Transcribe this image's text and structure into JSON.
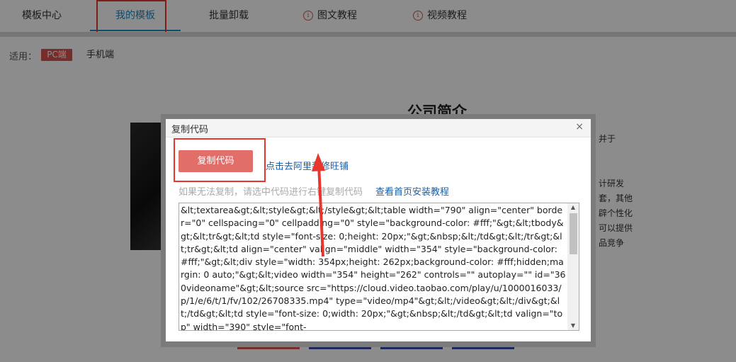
{
  "nav": {
    "items": [
      {
        "label": "模板中心"
      },
      {
        "label": "我的模板"
      },
      {
        "label": "批量卸载"
      },
      {
        "label": "图文教程"
      },
      {
        "label": "视频教程"
      }
    ],
    "info_glyph": "i"
  },
  "filter": {
    "label": "适用：",
    "options": [
      {
        "label": "PC端",
        "selected": true
      },
      {
        "label": "手机端",
        "selected": false
      }
    ]
  },
  "background": {
    "title": "公司简介",
    "snippets": [
      "并于",
      "计研发",
      "套，其他",
      "辟个性化",
      "可以提供",
      "品竞争"
    ]
  },
  "modal": {
    "title": "复制代码",
    "close_glyph": "×",
    "copy_button": "复制代码",
    "shop_link": "点击去阿里装修旺铺",
    "hint": "如果无法复制，请选中代码进行右键复制代码",
    "tutorial_link": "查看首页安装教程",
    "code": "&lt;textarea&gt;&lt;style&gt;&lt;/style&gt;&lt;table width=\"790\" align=\"center\" border=\"0\" cellspacing=\"0\" cellpadding=\"0\" style=\"background-color: #fff;\"&gt;&lt;tbody&gt;&lt;tr&gt;&lt;td style=\"font-size: 0;height: 20px;\"&gt;&nbsp;&lt;/td&gt;&lt;/tr&gt;&lt;tr&gt;&lt;td align=\"center\" valign=\"middle\" width=\"354\" style=\"background-color: #fff;\"&gt;&lt;div style=\"width: 354px;height: 262px;background-color: #fff;hidden;margin: 0 auto;\"&gt;&lt;video width=\"354\" height=\"262\" controls=\"\" autoplay=\"\" id=\"360videoname\"&gt;&lt;source src=\"https://cloud.video.taobao.com/play/u/1000016033/p/1/e/6/t/1/fv/102/26708335.mp4\" type=\"video/mp4\"&gt;&lt;/video&gt;&lt;/div&gt;&lt;/td&gt;&lt;td style=\"font-size: 0;width: 20px;\"&gt;&nbsp;&lt;/td&gt;&lt;td valign=\"top\" width=\"390\" style=\"font-",
    "scroll_up": "▲",
    "scroll_down": "▼"
  },
  "colors": {
    "accent_blue": "#1e88c7",
    "tag_red": "#d9534f",
    "copy_button": "#e26e6a",
    "highlight_red": "#e8352d",
    "link_blue": "#1a5fa8"
  }
}
